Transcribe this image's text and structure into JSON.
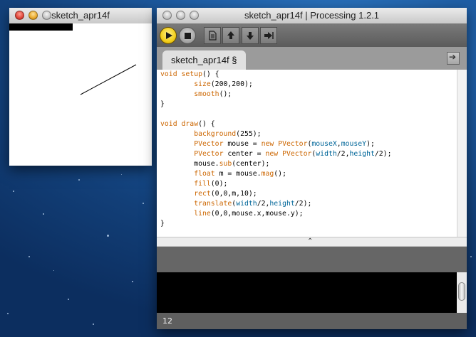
{
  "sketch_window": {
    "title": "sketch_apr14f"
  },
  "ide_window": {
    "title": "sketch_apr14f | Processing 1.2.1",
    "toolbar": {
      "buttons": [
        "run-icon",
        "stop-icon",
        "new-icon",
        "open-icon",
        "save-icon",
        "export-icon"
      ]
    },
    "tab": {
      "label": "sketch_apr14f §"
    },
    "code": [
      "void setup() {",
      "        size(200,200);",
      "        smooth();",
      "}",
      "",
      "void draw() {",
      "        background(255);",
      "        PVector mouse = new PVector(mouseX,mouseY);",
      "        PVector center = new PVector(width/2,height/2);",
      "        mouse.sub(center);",
      "        float m = mouse.mag();",
      "        fill(0);",
      "        rect(0,0,m,10);",
      "        translate(width/2,height/2);",
      "        line(0,0,mouse.x,mouse.y);",
      "}"
    ],
    "splitter_glyph": "⌃",
    "status": {
      "line_number": "12"
    }
  },
  "colors": {
    "keyword": "#cc6600",
    "builtin_var": "#006699",
    "run_button": "#f3cf1a"
  }
}
